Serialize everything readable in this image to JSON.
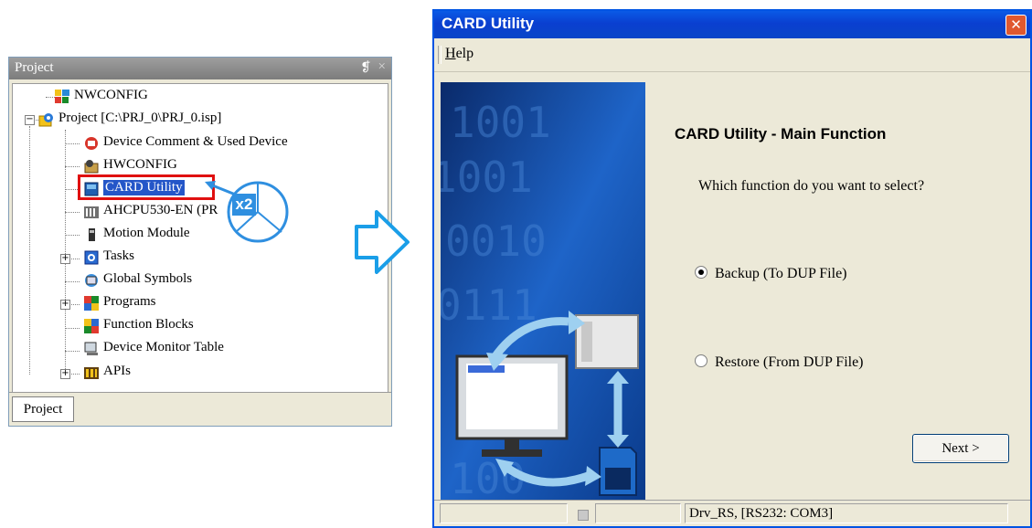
{
  "project_panel": {
    "title": "Project",
    "pin_glyph": "❡",
    "close_glyph": "×",
    "tab": "Project",
    "tree": [
      {
        "label": "NWCONFIG",
        "icon": "network-config-icon"
      },
      {
        "label": "Project [C:\\PRJ_0\\PRJ_0.isp]",
        "icon": "project-gear-icon"
      },
      {
        "label": "Device Comment & Used Device",
        "icon": "device-comment-icon"
      },
      {
        "label": "HWCONFIG",
        "icon": "hardware-config-icon"
      },
      {
        "label": "CARD Utility",
        "icon": "card-utility-icon"
      },
      {
        "label": "AHCPU530-EN  (PR",
        "icon": "cpu-icon"
      },
      {
        "label": "Motion Module",
        "icon": "motion-module-icon"
      },
      {
        "label": "Tasks",
        "icon": "tasks-icon"
      },
      {
        "label": "Global Symbols",
        "icon": "global-symbols-icon"
      },
      {
        "label": "Programs",
        "icon": "programs-icon"
      },
      {
        "label": "Function Blocks",
        "icon": "function-blocks-icon"
      },
      {
        "label": "Device Monitor Table",
        "icon": "device-monitor-icon"
      },
      {
        "label": "APIs",
        "icon": "apis-icon"
      }
    ],
    "callout": "x2"
  },
  "dialog": {
    "title": "CARD Utility",
    "close": "✕",
    "menu": {
      "help": "Help",
      "help_underline": "H",
      "help_rest": "elp"
    },
    "heading": "CARD Utility - Main Function",
    "question": "Which function do you want to select?",
    "options": [
      {
        "label": "Backup (To DUP File)",
        "selected": true
      },
      {
        "label": "Restore (From DUP File)",
        "selected": false
      }
    ],
    "next_button": "Next >",
    "status": "Drv_RS, [RS232: COM3]"
  },
  "colors": {
    "titlebar_blue": "#0a4ad8",
    "highlight_red": "#e01010",
    "arrow_blue": "#1a9ee8",
    "callout_blue": "#2f8fe0"
  }
}
